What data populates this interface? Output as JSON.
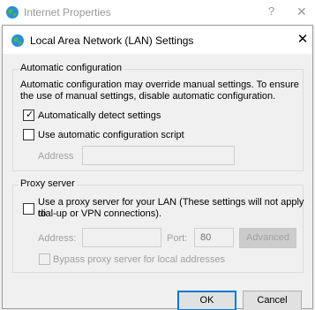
{
  "parent_window": {
    "title": "Internet Properties",
    "help_glyph": "?",
    "close_glyph": "✕"
  },
  "dialog": {
    "title": "Local Area Network (LAN) Settings",
    "close_glyph": "✕"
  },
  "auto_config": {
    "group_label": "Automatic configuration",
    "description_line1": "Automatic configuration may override manual settings.  To ensure",
    "description_line2": "the use of manual settings, disable automatic configuration.",
    "auto_detect_label": "Automatically detect settings",
    "auto_detect_checked": true,
    "use_script_label": "Use automatic configuration script",
    "use_script_checked": false,
    "address_label": "Address",
    "address_value": ""
  },
  "proxy": {
    "group_label": "Proxy server",
    "use_proxy_line1": "Use a proxy server for your LAN (These settings will not apply to",
    "use_proxy_line2": "dial-up or VPN connections).",
    "use_proxy_checked": false,
    "address_label": "Address:",
    "address_value": "",
    "port_label": "Port:",
    "port_value": "80",
    "advanced_label": "Advanced",
    "bypass_label": "Bypass proxy server for local addresses",
    "bypass_checked": false
  },
  "buttons": {
    "ok_label": "OK",
    "cancel_label": "Cancel"
  },
  "colors": {
    "accent": "#0078d7",
    "window_bg": "#f0f0f0",
    "titlebar_bg": "#ffffff",
    "disabled_text": "#a0a0a0"
  },
  "icons": {
    "app_icon": "internet-globe-icon"
  }
}
